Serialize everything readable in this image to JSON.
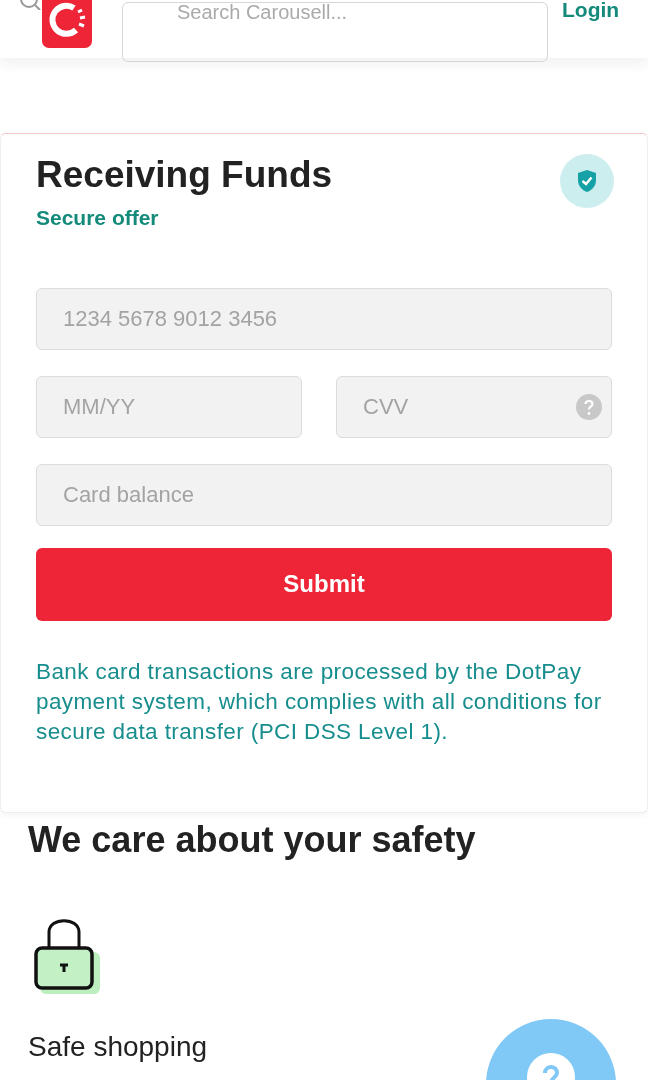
{
  "header": {
    "search_placeholder": "Search Carousell...",
    "login": "Login"
  },
  "card": {
    "title": "Receiving Funds",
    "subtitle": "Secure offer",
    "fields": [
      {
        "placeholder": "1234 5678 9012 3456"
      },
      {
        "placeholder": "MM/YY"
      },
      {
        "placeholder": "CVV"
      },
      {
        "placeholder": "Card balance"
      }
    ],
    "submit": "Submit",
    "note": "Bank card transactions are processed by the DotPay payment system, which complies with all conditions for secure data transfer (PCI DSS Level 1)."
  },
  "safety": {
    "heading": "We care about your safety",
    "feature": "Safe shopping"
  }
}
